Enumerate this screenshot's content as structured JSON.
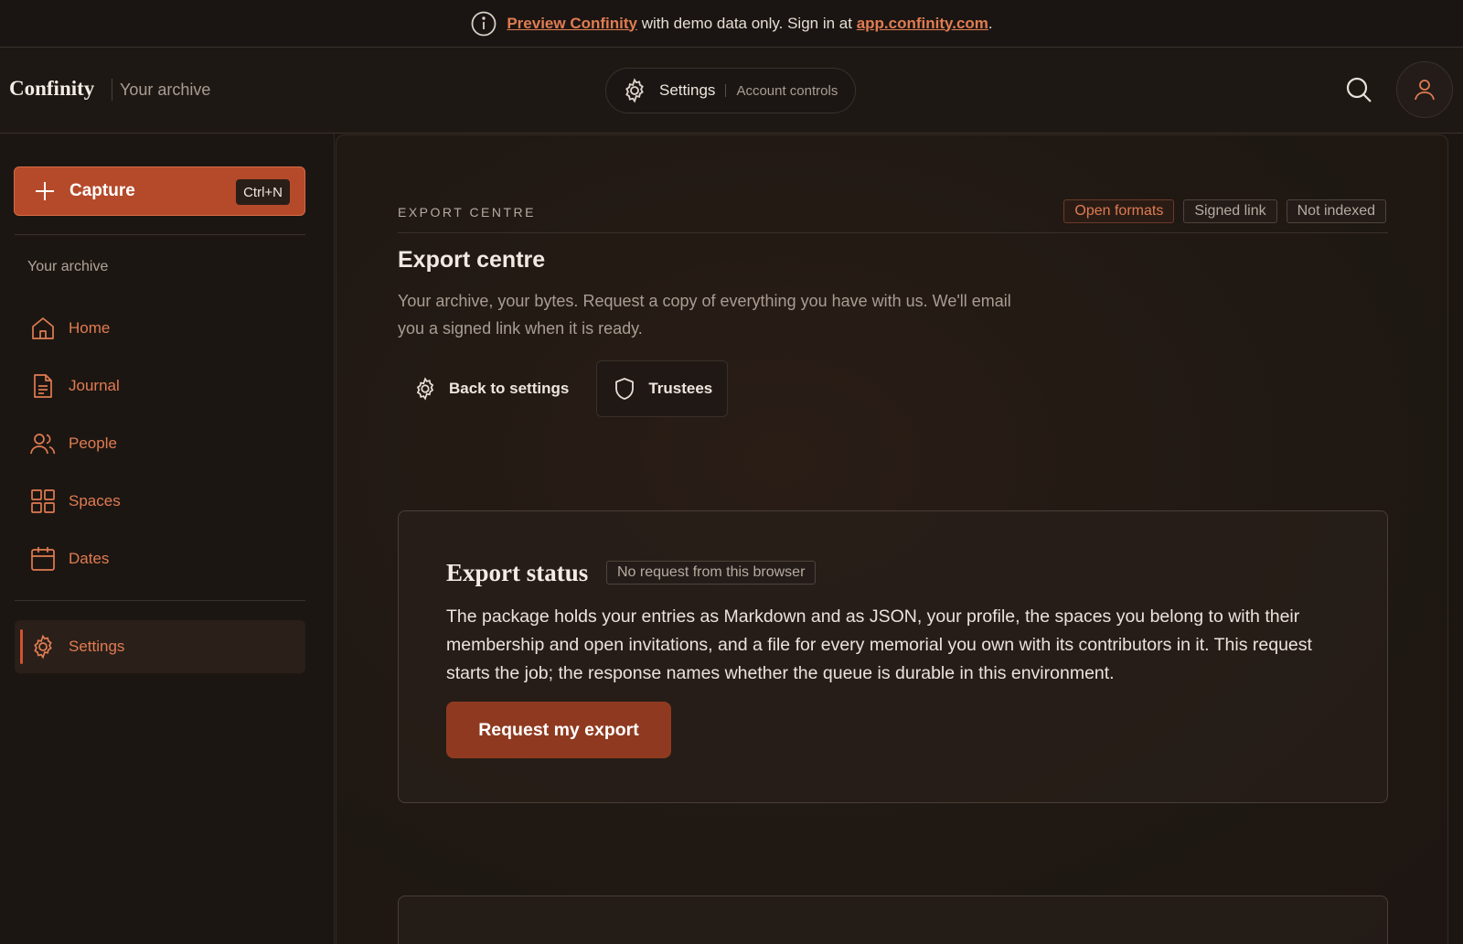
{
  "banner": {
    "icon": "info-icon",
    "link_text": "Preview Confinity",
    "middle_text": " with demo data only. Sign in at ",
    "url_text": "app.confinity.com",
    "end_text": "."
  },
  "header": {
    "logo": "Confinity",
    "subtitle": "Your archive",
    "pill_label": "Settings",
    "pill_sub": "Account controls",
    "search_icon": "search-icon",
    "avatar_icon": "user-icon"
  },
  "sidebar": {
    "capture_label": "Capture",
    "capture_shortcut": "Ctrl+N",
    "section_label": "Your archive",
    "items": [
      {
        "label": "Home",
        "icon": "home-icon"
      },
      {
        "label": "Journal",
        "icon": "document-icon"
      },
      {
        "label": "People",
        "icon": "people-icon"
      },
      {
        "label": "Spaces",
        "icon": "grid-icon"
      },
      {
        "label": "Dates",
        "icon": "calendar-icon"
      }
    ],
    "settings_label": "Settings"
  },
  "main": {
    "eyebrow": "EXPORT CENTRE",
    "tags": [
      "Open formats",
      "Signed link",
      "Not indexed"
    ],
    "title": "Export centre",
    "description": "Your archive, your bytes. Request a copy of everything you have with us. We'll email you a signed link when it is ready.",
    "back_label": "Back to settings",
    "trustees_label": "Trustees",
    "status": {
      "title": "Export status",
      "badge": "No request from this browser",
      "body": "The package holds your entries as Markdown and as JSON, your profile, the spaces you belong to with their membership and open invitations, and a file for every memorial you own with its contributors in it. This request starts the job; the response names whether the queue is durable in this environment.",
      "button": "Request my export"
    }
  },
  "colors": {
    "accent": "#e07c52",
    "primary_button": "#b54a2a",
    "background": "#1c1612"
  }
}
